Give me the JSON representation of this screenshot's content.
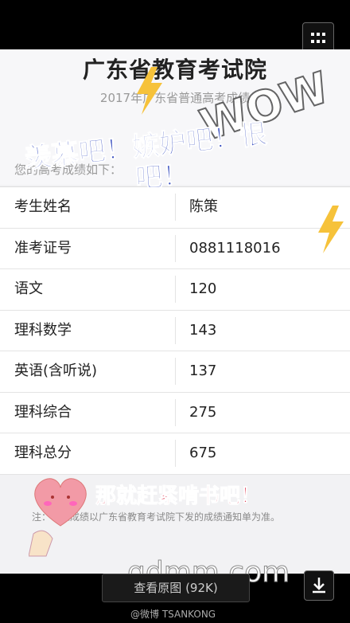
{
  "title": "广东省教育考试院",
  "subtitle": "2017年广东省普通高考成绩",
  "intro": "您的高考成绩如下：",
  "rows": [
    {
      "label": "考生姓名",
      "value": "陈策"
    },
    {
      "label": "准考证号",
      "value": "0881118016"
    },
    {
      "label": "语文",
      "value": "120"
    },
    {
      "label": "理科数学",
      "value": "143"
    },
    {
      "label": "英语(含听说)",
      "value": "137"
    },
    {
      "label": "理科综合",
      "value": "275"
    },
    {
      "label": "理科总分",
      "value": "675"
    }
  ],
  "note": "注：以上成绩以广东省教育考试院下发的成绩通知单为准。",
  "overlay": {
    "line1": "羡慕吧！嫉妒吧！恨",
    "line2": "吧！",
    "pink": "那就赶紧啃书吧！",
    "deco": "WOW"
  },
  "watermark": "gdmm.com",
  "view_original": "查看原图 (92K)",
  "weibo_credit": "@微博 TSANKONG",
  "icons": [
    "grid-icon",
    "download-icon",
    "lightning-icon",
    "heart-icon"
  ]
}
